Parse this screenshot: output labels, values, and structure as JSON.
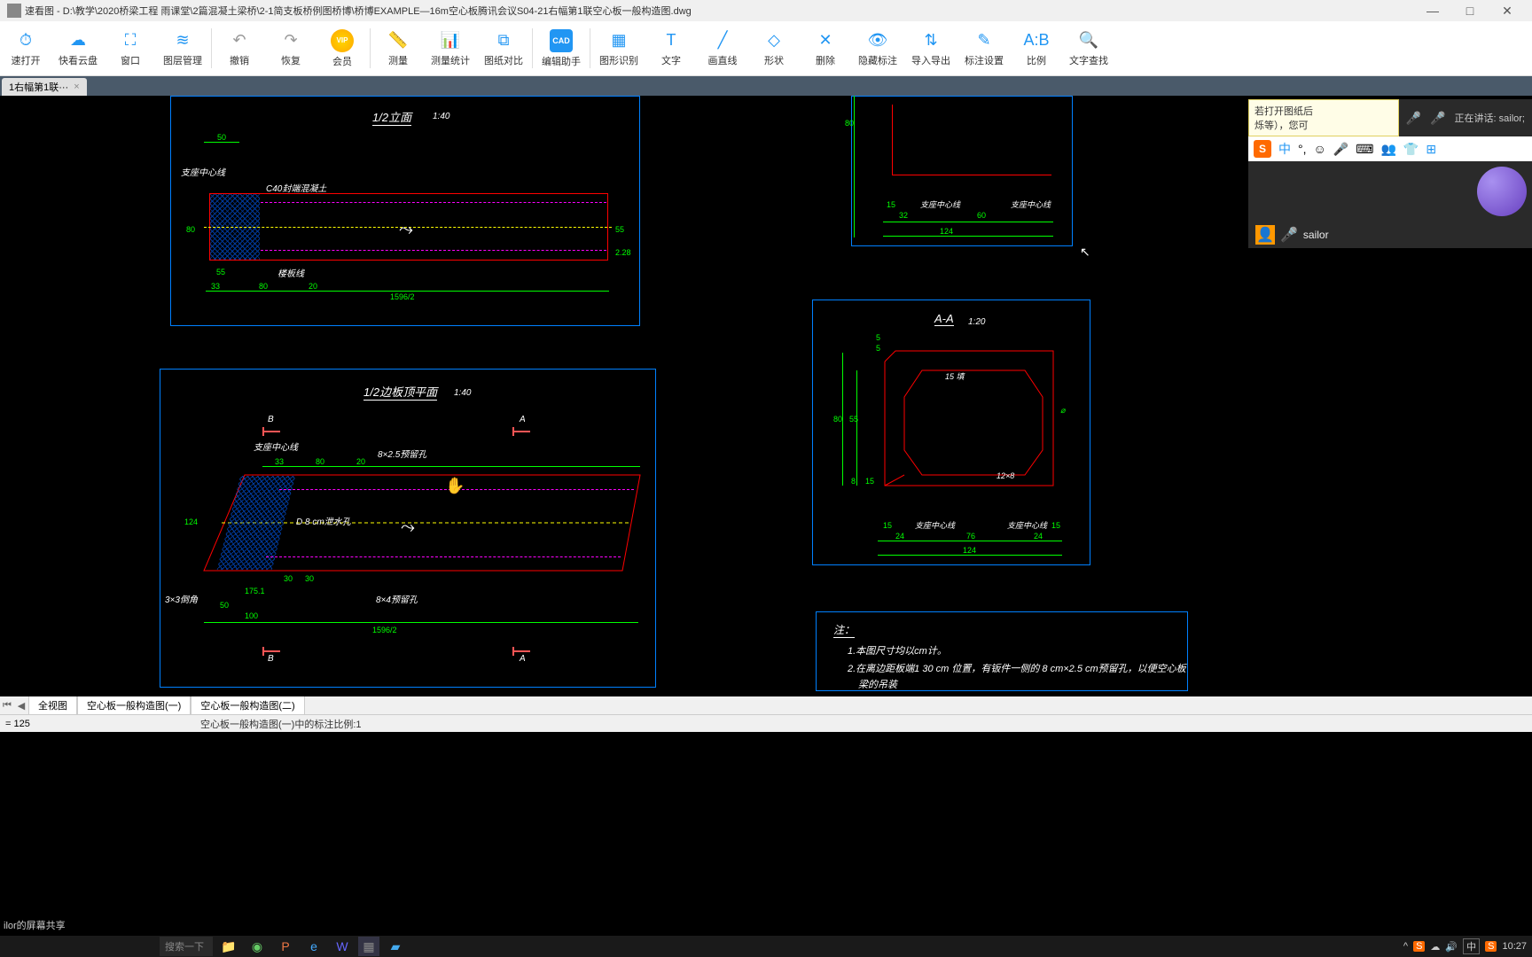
{
  "title": "速看图 - D:\\教学\\2020桥梁工程 雨课堂\\2篇混凝土梁桥\\2-1简支板桥例图桥博\\桥博EXAMPLE—16m空心板腾讯会议S04-21右幅第1联空心板一般构造图.dwg",
  "overlay_app": "腾讯会议",
  "toolbar": [
    {
      "label": "速打开",
      "icon": "⏱",
      "cls": "blue"
    },
    {
      "label": "快看云盘",
      "icon": "☁",
      "cls": "blue"
    },
    {
      "label": "窗口",
      "icon": "⛶",
      "cls": "blue"
    },
    {
      "label": "图层管理",
      "icon": "≋",
      "cls": "blue"
    },
    {
      "label": "撤销",
      "icon": "↶",
      "cls": "gray"
    },
    {
      "label": "恢复",
      "icon": "↷",
      "cls": "gray"
    },
    {
      "label": "会员",
      "icon": "VIP",
      "cls": "vip"
    },
    {
      "label": "测量",
      "icon": "📏",
      "cls": "blue"
    },
    {
      "label": "测量统计",
      "icon": "📊",
      "cls": "blue"
    },
    {
      "label": "图纸对比",
      "icon": "⧉",
      "cls": "blue"
    },
    {
      "label": "编辑助手",
      "icon": "CAD",
      "cls": "cad"
    },
    {
      "label": "图形识别",
      "icon": "▦",
      "cls": "blue"
    },
    {
      "label": "文字",
      "icon": "T",
      "cls": "blue"
    },
    {
      "label": "画直线",
      "icon": "╱",
      "cls": "blue"
    },
    {
      "label": "形状",
      "icon": "◇",
      "cls": "blue"
    },
    {
      "label": "删除",
      "icon": "✕",
      "cls": "blue"
    },
    {
      "label": "隐藏标注",
      "icon": "👁",
      "cls": "blue"
    },
    {
      "label": "导入导出",
      "icon": "⇅",
      "cls": "blue"
    },
    {
      "label": "标注设置",
      "icon": "✎",
      "cls": "blue"
    },
    {
      "label": "比例",
      "icon": "A:B",
      "cls": "blue"
    },
    {
      "label": "文字查找",
      "icon": "🔍",
      "cls": "blue"
    }
  ],
  "tab": {
    "label": "1右幅第1联···",
    "close": "×"
  },
  "drawing": {
    "view1": {
      "title": "1/2立面",
      "scale": "1:40"
    },
    "view2": {
      "title": "1/2边板顶平面",
      "scale": "1:40"
    },
    "view3": {
      "title": "A-A",
      "scale": "1:20"
    },
    "labels": {
      "zhizuo": "支座中心线",
      "c40": "C40封端混凝土",
      "loubanxian": "楼板线",
      "pipe": "D 8 cm泄水孔",
      "hole1": "8×2.5预留孔",
      "hole2": "8×4预留孔",
      "chamfer": "3×3倒角",
      "dim15x8": "12×8",
      "dim15": "15 填"
    },
    "dims": {
      "d50": "50",
      "d80_1": "80",
      "d55_1": "55",
      "d33": "33",
      "d80_2": "80",
      "d20": "20",
      "d1596": "1596/2",
      "d55_2": "55",
      "d2": "2.28",
      "d124": "124",
      "d60": "60",
      "d32": "32",
      "d15": "15",
      "d100": "100",
      "d175": "175.1",
      "d30_1": "30",
      "d30_2": "30",
      "d5_1": "5",
      "d5_2": "5",
      "d15_2": "15",
      "d15_3": "15",
      "d24_1": "24",
      "d24_2": "24",
      "d76": "76",
      "d8": "8",
      "d80_3": "80",
      "d55_3": "55",
      "d124_2": "124",
      "d124_3": "124"
    },
    "sections": {
      "A": "A",
      "B": "B"
    },
    "notes": {
      "title": "注：",
      "n1": "1.本图尺寸均以cm计。",
      "n2": "2.在离边距板端1 30 cm 位置，有钣件一侧的 8 cm×2.5 cm预留孔，以便空心板",
      "n3": "梁的吊装"
    }
  },
  "bottom_tabs": [
    "全视图",
    "空心板一般构造图(一)",
    "空心板一般构造图(二)"
  ],
  "status": {
    "left": "= 125",
    "mid": "空心板一般构造图(一)中的标注比例:1"
  },
  "meeting": {
    "tip1": "若打开图纸后",
    "tip2": "烁等），您可",
    "speaking": "正在讲话: sailor;",
    "user": "sailor",
    "ime_mode": "中"
  },
  "share_bar": "ilor的屏幕共享",
  "taskbar": {
    "search": "搜索一下",
    "time": "10:27",
    "lang": "中"
  }
}
